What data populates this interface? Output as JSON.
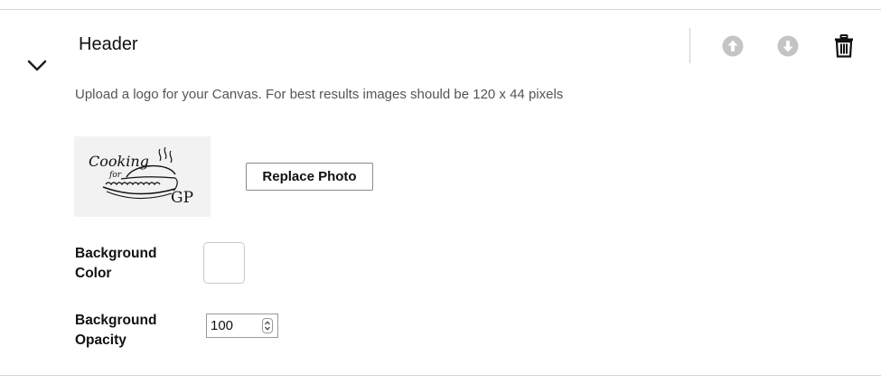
{
  "section": {
    "title": "Header",
    "collapse_icon": "chevron-down-icon",
    "actions": {
      "move_up_icon": "arrow-up-circle-icon",
      "move_down_icon": "arrow-down-circle-icon",
      "delete_icon": "trash-icon"
    }
  },
  "logo": {
    "hint": "Upload a logo for your Canvas. For best results images should be 120 x 44 pixels",
    "image_text_line1": "Cooking",
    "image_text_line2": "for",
    "image_text_line3": "GP",
    "replace_label": "Replace Photo"
  },
  "background_color": {
    "label": "Background Color",
    "value": "#ffffff"
  },
  "background_opacity": {
    "label": "Background Opacity",
    "value": "100"
  },
  "colors": {
    "disabled_icon": "#c4c4c4",
    "text": "#111111",
    "muted_text": "#555555",
    "divider": "#d4d4d4"
  }
}
